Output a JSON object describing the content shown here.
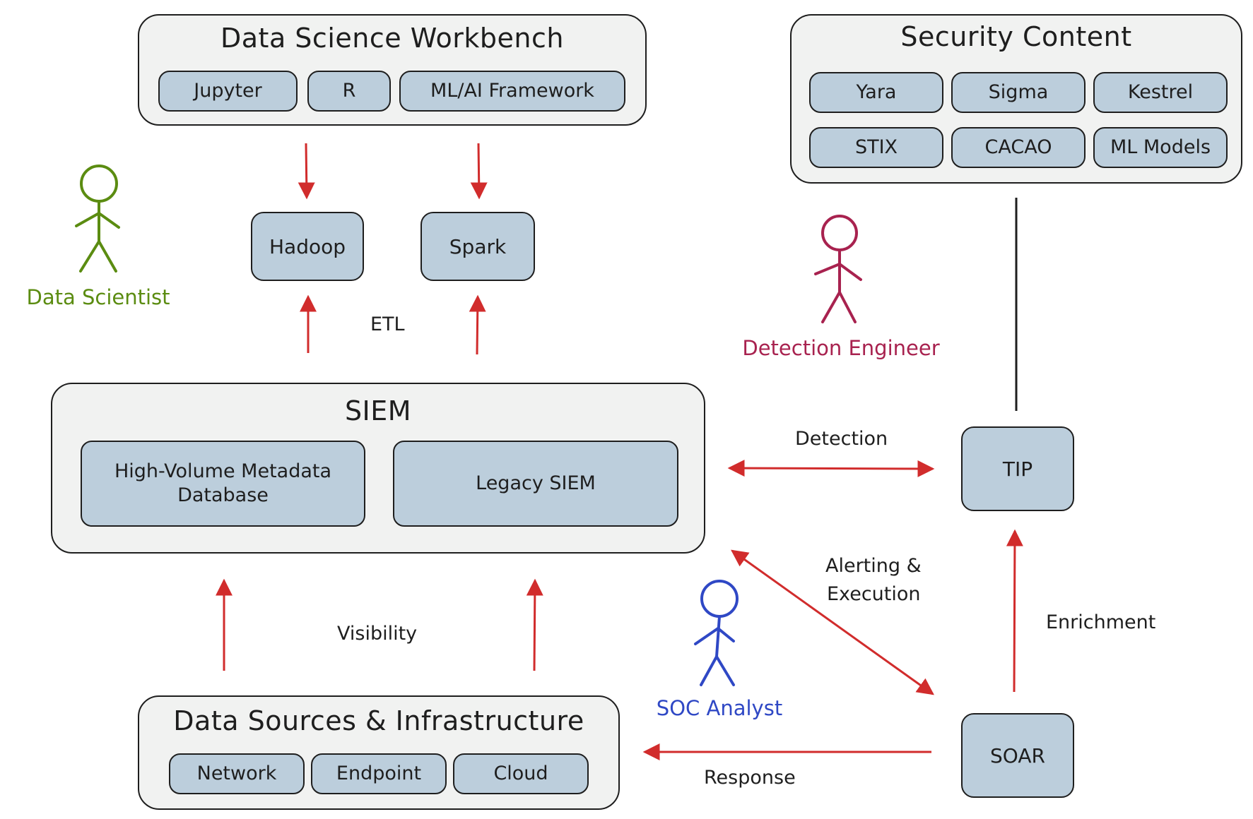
{
  "workbench": {
    "title": "Data Science Workbench",
    "items": [
      "Jupyter",
      "R",
      "ML/AI Framework"
    ]
  },
  "security_content": {
    "title": "Security Content",
    "items": [
      "Yara",
      "Sigma",
      "Kestrel",
      "STIX",
      "CACAO",
      "ML Models"
    ]
  },
  "siem": {
    "title": "SIEM",
    "items": [
      "High-Volume Metadata Database",
      "Legacy SIEM"
    ]
  },
  "data_sources": {
    "title": "Data Sources & Infrastructure",
    "items": [
      "Network",
      "Endpoint",
      "Cloud"
    ]
  },
  "nodes": {
    "hadoop": "Hadoop",
    "spark": "Spark",
    "tip": "TIP",
    "soar": "SOAR"
  },
  "edge_labels": {
    "etl": "ETL",
    "detection": "Detection",
    "alerting": "Alerting &",
    "execution": "Execution",
    "visibility": "Visibility",
    "enrichment": "Enrichment",
    "response": "Response"
  },
  "personas": {
    "data_scientist": {
      "label": "Data Scientist",
      "color": "#5b8c11"
    },
    "detection_engineer": {
      "label": "Detection Engineer",
      "color": "#a8224f"
    },
    "soc_analyst": {
      "label": "SOC Analyst",
      "color": "#2f48c5"
    }
  },
  "colors": {
    "arrow": "#d12c2c",
    "box_fill": "#bccedc",
    "group_fill": "#f1f2f1",
    "stroke": "#1e1e1e"
  }
}
